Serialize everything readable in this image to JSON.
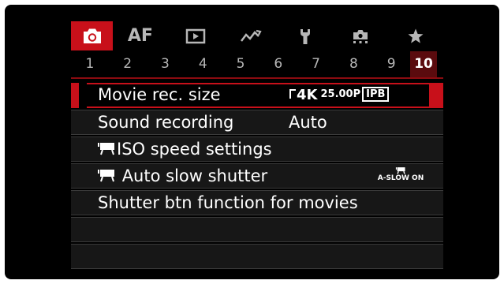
{
  "tabs": [
    {
      "icon": "camera-icon",
      "active": true
    },
    {
      "label": "AF"
    },
    {
      "icon": "playback-icon"
    },
    {
      "icon": "wireless-icon"
    },
    {
      "icon": "wrench-icon"
    },
    {
      "icon": "custom-functions-icon"
    },
    {
      "icon": "star-icon"
    }
  ],
  "pages": [
    "1",
    "2",
    "3",
    "4",
    "5",
    "6",
    "7",
    "8",
    "9",
    "10"
  ],
  "active_page": "10",
  "menu": [
    {
      "label": "Movie rec. size",
      "value_format": "4K",
      "value_rate": "25.00P",
      "value_comp": "IPB"
    },
    {
      "label": "Sound recording",
      "value": "Auto"
    },
    {
      "label": "ISO speed settings"
    },
    {
      "label": "Auto slow shutter",
      "value": "A-SLOW ON"
    },
    {
      "label": "Shutter btn function for movies"
    }
  ],
  "colors": {
    "accent": "#c8101a",
    "background": "#000000",
    "text": "#ffffff",
    "muted": "#b7b7b7"
  }
}
